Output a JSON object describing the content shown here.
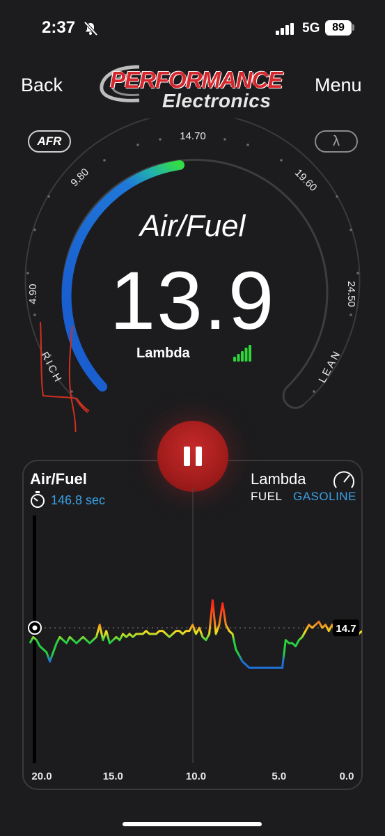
{
  "status": {
    "time": "2:37",
    "network": "5G",
    "battery": "89"
  },
  "header": {
    "back_label": "Back",
    "menu_label": "Menu",
    "logo_line1": "PERFORMANCE",
    "logo_line2": "Electronics"
  },
  "gauge": {
    "afr_button": "AFR",
    "lambda_button": "λ",
    "title": "Air/Fuel",
    "value": "13.9",
    "sub_label": "Lambda",
    "tick_labels": [
      "4.90",
      "9.80",
      "14.70",
      "19.60",
      "24.50"
    ],
    "rich_label": "RICH",
    "lean_label": "LEAN",
    "range_min": 4.9,
    "range_max": 24.5
  },
  "panel": {
    "title": "Air/Fuel",
    "elapsed": "146.8 sec",
    "right_title": "Lambda",
    "fuel_label": "FUEL",
    "fuel_value": "GASOLINE"
  },
  "chart_data": {
    "type": "line",
    "title": "Air/Fuel",
    "xlabel": "",
    "ylabel": "",
    "x_ticks": [
      "20.0",
      "15.0",
      "10.0",
      "5.0",
      "0.0"
    ],
    "xlim": [
      20,
      0
    ],
    "ylim": [
      12,
      17
    ],
    "reference_value": 14.7,
    "reference_label": "14.7",
    "colors": {
      "lean": "#ff2a1a",
      "mid": "#f0e020",
      "stoich": "#28d040",
      "rich": "#1f6fd6"
    },
    "x": [
      20.0,
      19.8,
      19.6,
      19.4,
      19.2,
      19.0,
      18.8,
      18.6,
      18.4,
      18.2,
      18.0,
      17.8,
      17.6,
      17.4,
      17.2,
      17.0,
      16.8,
      16.6,
      16.4,
      16.2,
      16.0,
      15.8,
      15.6,
      15.4,
      15.2,
      15.0,
      14.8,
      14.6,
      14.4,
      14.2,
      14.0,
      13.8,
      13.6,
      13.4,
      13.2,
      13.0,
      12.8,
      12.6,
      12.4,
      12.2,
      12.0,
      11.8,
      11.6,
      11.4,
      11.2,
      11.0,
      10.8,
      10.6,
      10.4,
      10.2,
      10.0,
      9.8,
      9.6,
      9.4,
      9.2,
      9.0,
      8.8,
      8.6,
      8.4,
      8.2,
      8.0,
      7.8,
      7.6,
      7.4,
      7.2,
      7.0,
      6.8,
      6.6,
      6.4,
      6.2,
      6.0,
      5.8,
      5.6,
      5.4,
      5.2,
      5.0,
      4.8,
      4.6,
      4.4,
      4.2,
      4.0,
      3.8,
      3.6,
      3.4,
      3.2,
      3.0,
      2.8,
      2.6,
      2.4,
      2.2,
      2.0,
      1.8,
      1.6,
      1.4,
      1.2,
      1.0,
      0.8,
      0.6,
      0.4,
      0.2,
      0.0
    ],
    "y": [
      14.2,
      14.4,
      14.3,
      14.1,
      14.0,
      13.9,
      13.6,
      13.9,
      14.2,
      14.4,
      14.3,
      14.2,
      14.4,
      14.3,
      14.2,
      14.3,
      14.4,
      14.3,
      14.2,
      14.3,
      14.4,
      14.8,
      14.3,
      14.6,
      14.2,
      14.3,
      14.4,
      14.3,
      14.5,
      14.4,
      14.5,
      14.4,
      14.5,
      14.5,
      14.5,
      14.6,
      14.5,
      14.5,
      14.5,
      14.6,
      14.6,
      14.5,
      14.4,
      14.5,
      14.6,
      14.6,
      14.5,
      14.6,
      14.6,
      14.8,
      14.5,
      14.7,
      14.4,
      14.3,
      14.5,
      15.6,
      14.5,
      14.8,
      15.5,
      14.8,
      14.6,
      14.5,
      14.0,
      13.8,
      13.6,
      13.5,
      13.4,
      13.4,
      13.4,
      13.4,
      13.4,
      13.4,
      13.4,
      13.4,
      13.4,
      13.4,
      13.4,
      14.3,
      14.2,
      14.2,
      14.1,
      14.3,
      14.4,
      14.6,
      14.8,
      14.7,
      14.8,
      14.9,
      14.7,
      14.8,
      14.6,
      14.8,
      14.6,
      14.6,
      14.6,
      14.6,
      14.6,
      14.6,
      14.5,
      14.5,
      14.6
    ]
  }
}
